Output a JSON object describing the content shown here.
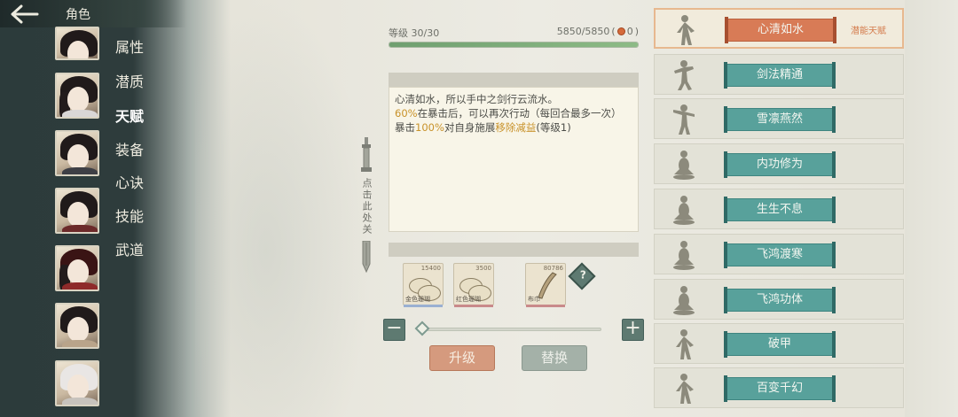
{
  "header": {
    "title": "角色"
  },
  "sidebar": {
    "menu": [
      "属性",
      "潜质",
      "天赋",
      "装备",
      "心诀",
      "技能",
      "武道"
    ],
    "active_index": 2
  },
  "level": {
    "label": "等级 30/30",
    "exp": "5850/5850",
    "coin": "0",
    "progress": 1.0
  },
  "description": {
    "line1": "心清如水，所以手中之剑行云流水。",
    "line2_pct": "60%",
    "line2_rest": "在暴击后，可以再次行动（每回合最多一次）",
    "line3_pre": "暴击",
    "line3_pct": "100%",
    "line3_mid": "对自身施展",
    "line3_effect": "移除减益",
    "line3_post": "(等级1)"
  },
  "hint": {
    "text": "点击此处关"
  },
  "items": [
    {
      "count": "15400",
      "name": "金色珊瑚"
    },
    {
      "count": "3500",
      "name": "红色珊瑚"
    },
    {
      "count": "80786",
      "name": "布巾"
    }
  ],
  "help": {
    "label": "?"
  },
  "slider": {
    "value": 0,
    "minus": "−",
    "plus": "+"
  },
  "actions": {
    "upgrade": "升级",
    "replace": "替换"
  },
  "talents": [
    {
      "name": "心清如水",
      "tag": "潜能天赋",
      "selected": true
    },
    {
      "name": "剑法精通",
      "tag": ""
    },
    {
      "name": "雪凛燕然",
      "tag": ""
    },
    {
      "name": "内功修为",
      "tag": ""
    },
    {
      "name": "生生不息",
      "tag": ""
    },
    {
      "name": "飞鸿渡寒",
      "tag": ""
    },
    {
      "name": "飞鸿功体",
      "tag": ""
    },
    {
      "name": "破甲",
      "tag": ""
    },
    {
      "name": "百变千幻",
      "tag": ""
    }
  ],
  "colors": {
    "accent": "#d87b56",
    "teal": "#58a19b",
    "panel": "#f8f5e8",
    "highlight": "#c8922a"
  }
}
